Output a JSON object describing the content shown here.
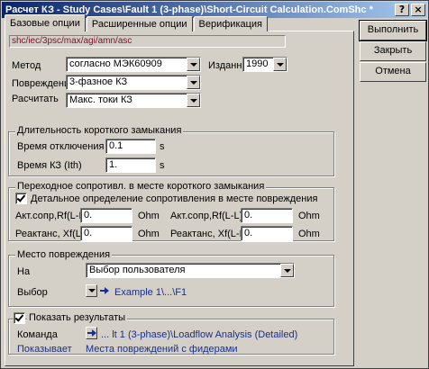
{
  "window": {
    "title": "Расчет КЗ - Study Cases\\Fault 1 (3-phase)\\Short-Circuit Calculation.ComShc *",
    "help_glyph": "?",
    "close_glyph": "×"
  },
  "tabs": [
    {
      "label": "Базовые опции",
      "active": true
    },
    {
      "label": "Расширенные опции",
      "active": false
    },
    {
      "label": "Верификация",
      "active": false
    }
  ],
  "path": "shc/iec/3psc/max/agi/amn/asc",
  "method": {
    "label": "Метод",
    "value": "согласно МЭК60909"
  },
  "published": {
    "label": "Изданный",
    "value": "1990"
  },
  "fault_type": {
    "label": "Повреждение",
    "value": "3-фазное КЗ"
  },
  "calculate": {
    "label": "Расчитать",
    "value": "Макс. токи КЗ"
  },
  "duration": {
    "title": "Длительность короткого замыкания",
    "break_time_label": "Время отключения",
    "break_time_value": "0.1",
    "break_time_unit": "s",
    "fault_time_label": "Время КЗ (Ith)",
    "fault_time_value": "1.",
    "fault_time_unit": "s"
  },
  "impedance": {
    "title": "Переходное сопротивл. в месте короткого замыкания",
    "detailed_label": "Детальное определение сопротивления в месте повреждения",
    "detailed_checked": true,
    "rf_le_label": "Акт.сопр,Rf(L-E)",
    "rf_le_value": "0.",
    "rf_le_unit": "Ohm",
    "rf_ll_label": "Акт.сопр,Rf(L-L)",
    "rf_ll_value": "0.",
    "rf_ll_unit": "Ohm",
    "xf_le_label": "Реактанс, Xf(L-E)",
    "xf_le_value": "0.",
    "xf_le_unit": "Ohm",
    "xf_ll_label": "Реактанс, Xf(L-L)",
    "xf_ll_value": "0.",
    "xf_ll_unit": "Ohm"
  },
  "location": {
    "title": "Место повреждения",
    "at_label": "На",
    "at_value": "Выбор пользователя",
    "selection_label": "Выбор",
    "selection_link": "Example 1\\...\\F1"
  },
  "results": {
    "show_label": "Показать результаты",
    "show_checked": true,
    "command_label": "Команда",
    "command_link": "... lt 1 (3-phase)\\Loadflow Analysis (Detailed)",
    "shows_label": "Показывает",
    "shows_value": "Места повреждений с фидерами"
  },
  "buttons": {
    "execute": "Выполнить",
    "close": "Закрыть",
    "cancel": "Отмена"
  }
}
